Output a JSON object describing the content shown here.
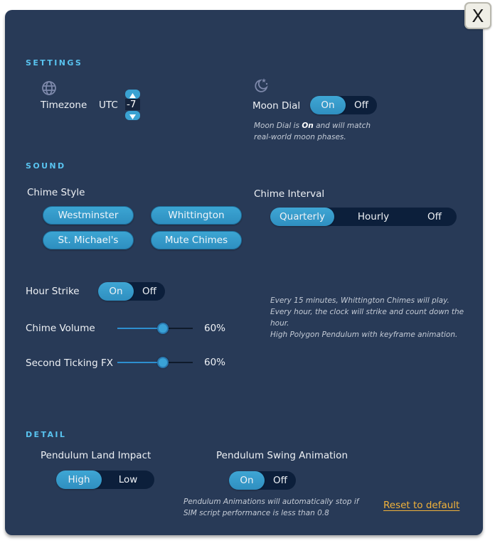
{
  "close_button": {
    "label": "X"
  },
  "settings": {
    "title": "SETTINGS",
    "timezone": {
      "icon": "globe-icon",
      "label": "Timezone",
      "prefix": "UTC",
      "value": "-7"
    },
    "moon_dial": {
      "icon": "moon-stars-icon",
      "label": "Moon Dial",
      "options": [
        "On",
        "Off"
      ],
      "selected": "On",
      "note_before": "Moon Dial is ",
      "note_bold": "On",
      "note_after": " and will match real-world moon phases."
    }
  },
  "sound": {
    "title": "SOUND",
    "chime_style": {
      "label": "Chime Style",
      "options": [
        "Westminster",
        "Whittington",
        "St. Michael's",
        "Mute Chimes"
      ]
    },
    "chime_interval": {
      "label": "Chime Interval",
      "options": [
        "Quarterly",
        "Hourly",
        "Off"
      ],
      "selected": "Quarterly"
    },
    "hour_strike": {
      "label": "Hour Strike",
      "options": [
        "On",
        "Off"
      ],
      "selected": "On"
    },
    "chime_volume": {
      "label": "Chime Volume",
      "value": 60,
      "display": "60%"
    },
    "second_ticking": {
      "label": "Second Ticking FX",
      "value": 60,
      "display": "60%"
    },
    "summary": [
      "Every 15 minutes, Whittington Chimes will play.",
      "Every hour, the clock will strike and count down the hour.",
      "High Polygon Pendulum with keyframe animation."
    ]
  },
  "detail": {
    "title": "DETAIL",
    "land_impact": {
      "label": "Pendulum Land Impact",
      "options": [
        "High",
        "Low"
      ],
      "selected": "High"
    },
    "swing_animation": {
      "label": "Pendulum Swing Animation",
      "options": [
        "On",
        "Off"
      ],
      "selected": "On",
      "note": "Pendulum Animations will automatically stop if SIM script performance is less than 0.8"
    },
    "reset_label": "Reset to default"
  },
  "colors": {
    "panel_bg": "#283a57",
    "accent": "#3aa2d2",
    "section_title": "#59c3ef",
    "toggle_track": "#0c1f3b",
    "link": "#f1b23a"
  }
}
